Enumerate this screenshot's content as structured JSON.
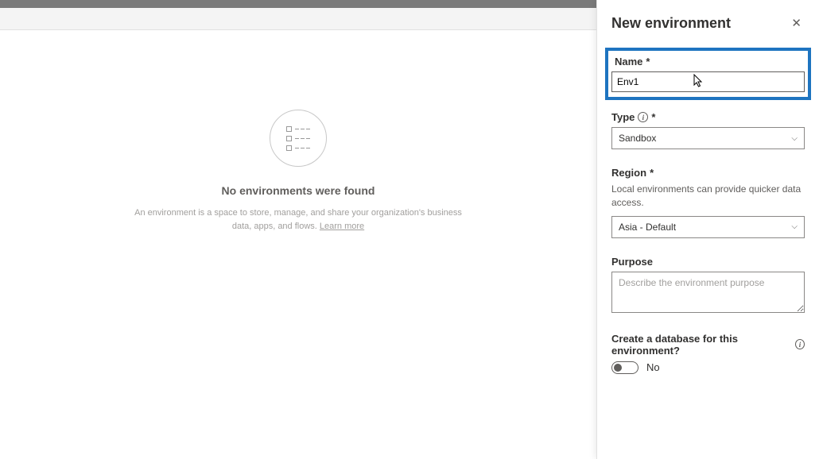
{
  "empty": {
    "title": "No environments were found",
    "desc_prefix": "An environment is a space to store, manage, and share your organization's business data, apps, and flows. ",
    "learn_more": "Learn more"
  },
  "panel": {
    "title": "New environment",
    "name": {
      "label": "Name",
      "value": "Env1"
    },
    "type": {
      "label": "Type",
      "value": "Sandbox"
    },
    "region": {
      "label": "Region",
      "help": "Local environments can provide quicker data access.",
      "value": "Asia - Default"
    },
    "purpose": {
      "label": "Purpose",
      "placeholder": "Describe the environment purpose"
    },
    "database": {
      "label": "Create a database for this environment?",
      "value": "No"
    }
  }
}
